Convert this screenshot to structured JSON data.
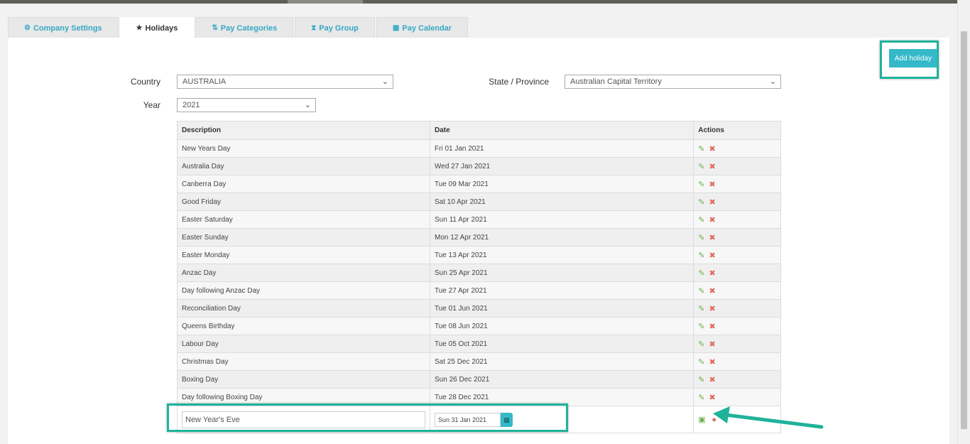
{
  "tabs": [
    {
      "label": "Company Settings",
      "icon": "gear-icon",
      "glyph": "⚙"
    },
    {
      "label": "Holidays",
      "icon": "star-icon",
      "glyph": "★"
    },
    {
      "label": "Pay Categories",
      "icon": "sort-icon",
      "glyph": "⇅"
    },
    {
      "label": "Pay Group",
      "icon": "hourglass-icon",
      "glyph": "⧗"
    },
    {
      "label": "Pay Calendar",
      "icon": "calendar-icon",
      "glyph": "▦"
    }
  ],
  "add_holiday_label": "Add holiday",
  "filters": {
    "country_label": "Country",
    "country_value": "AUSTRALIA",
    "state_label": "State / Province",
    "state_value": "Australian Capital Territory",
    "year_label": "Year",
    "year_value": "2021"
  },
  "table": {
    "headers": [
      "Description",
      "Date",
      "Actions"
    ],
    "rows": [
      {
        "description": "New Years Day",
        "date": "Fri 01 Jan 2021"
      },
      {
        "description": "Australia Day",
        "date": "Wed 27 Jan 2021"
      },
      {
        "description": "Canberra Day",
        "date": "Tue 09 Mar 2021"
      },
      {
        "description": "Good Friday",
        "date": "Sat 10 Apr 2021"
      },
      {
        "description": "Easter Saturday",
        "date": "Sun 11 Apr 2021"
      },
      {
        "description": "Easter Sunday",
        "date": "Mon 12 Apr 2021"
      },
      {
        "description": "Easter Monday",
        "date": "Tue 13 Apr 2021"
      },
      {
        "description": "Anzac Day",
        "date": "Sun 25 Apr 2021"
      },
      {
        "description": "Day following Anzac Day",
        "date": "Tue 27 Apr 2021"
      },
      {
        "description": "Reconciliation Day",
        "date": "Tue 01 Jun 2021"
      },
      {
        "description": "Queens Birthday",
        "date": "Tue 08 Jun 2021"
      },
      {
        "description": "Labour Day",
        "date": "Tue 05 Oct 2021"
      },
      {
        "description": "Christmas Day",
        "date": "Sat 25 Dec 2021"
      },
      {
        "description": "Boxing Day",
        "date": "Sun 26 Dec 2021"
      },
      {
        "description": "Day following Boxing Day",
        "date": "Tue 28 Dec 2021"
      }
    ],
    "new_row": {
      "description_value": "New Year's Eve",
      "date_value": "Sun 31 Jan 2021"
    }
  },
  "colors": {
    "accent": "#35b9c9",
    "highlight": "#1fb39a",
    "edit": "#6ab04c",
    "delete": "#e06a5a"
  }
}
